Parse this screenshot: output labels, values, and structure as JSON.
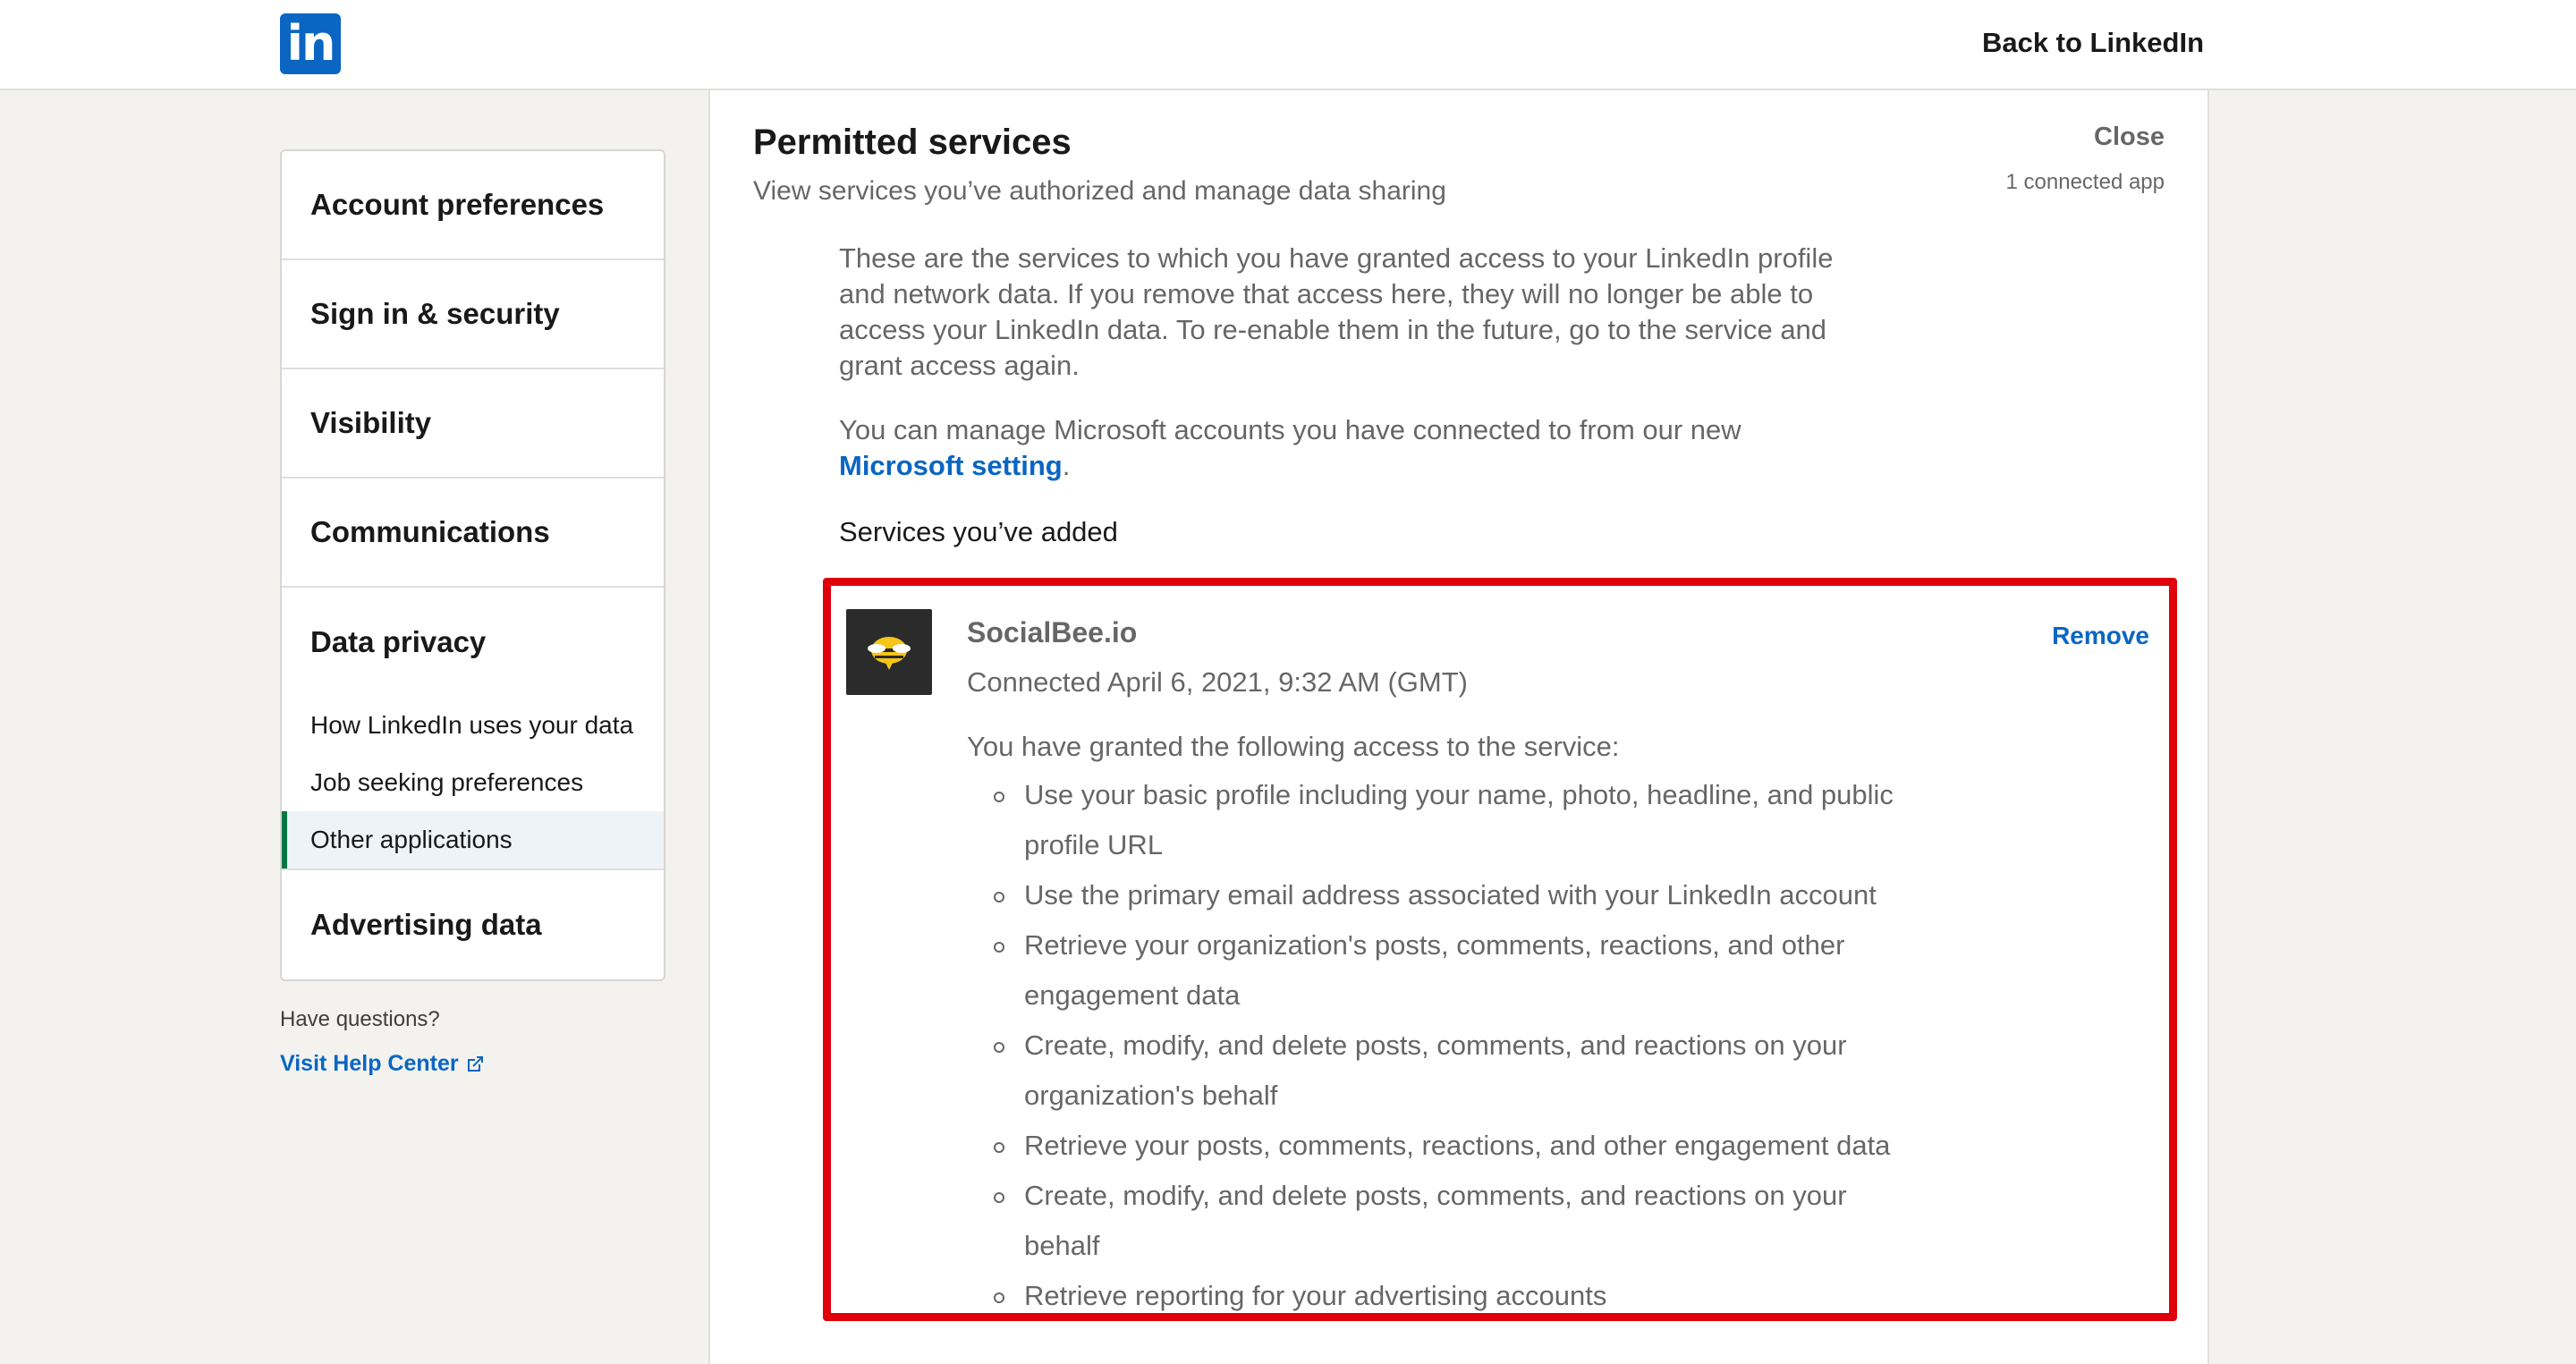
{
  "header": {
    "logo_text": "in",
    "back_link": "Back to LinkedIn"
  },
  "sidebar": {
    "items": [
      {
        "label": "Account preferences"
      },
      {
        "label": "Sign in & security"
      },
      {
        "label": "Visibility"
      },
      {
        "label": "Communications"
      },
      {
        "label": "Data privacy",
        "sub_items": [
          {
            "label": "How LinkedIn uses your data"
          },
          {
            "label": "Job seeking preferences"
          },
          {
            "label": "Other applications",
            "active": true
          }
        ]
      },
      {
        "label": "Advertising data"
      }
    ],
    "help_question": "Have questions?",
    "help_link": "Visit Help Center"
  },
  "main": {
    "title": "Permitted services",
    "subtitle": "View services you’ve authorized and manage data sharing",
    "close_label": "Close",
    "connected_count": "1 connected app",
    "description": "These are the services to which you have granted access to your LinkedIn profile and network data. If you remove that access here, they will no longer be able to access your LinkedIn data. To re-enable them in the future, go to the service and grant access again.",
    "microsoft_text": "You can manage Microsoft accounts you have connected to from our new",
    "microsoft_link": "Microsoft setting",
    "microsoft_period": ".",
    "services_added_label": "Services you’ve added",
    "service": {
      "name": "SocialBee.io",
      "connected": "Connected April 6, 2021, 9:32 AM (GMT)",
      "remove_label": "Remove",
      "access_intro": "You have granted the following access to the service:",
      "permissions": [
        "Use your basic profile including your name, photo, headline, and public profile URL",
        "Use the primary email address associated with your LinkedIn account",
        "Retrieve your organization's posts, comments, reactions, and other engagement data",
        "Create, modify, and delete posts, comments, and reactions on your organization's behalf",
        "Retrieve your posts, comments, reactions, and other engagement data",
        "Create, modify, and delete posts, comments, and reactions on your behalf",
        "Retrieve reporting for your advertising accounts"
      ]
    }
  },
  "colors": {
    "brand": "#0a66c2",
    "highlight": "#e0000b",
    "active_indicator": "#057642"
  },
  "icons": {
    "external_link": "external-link-icon",
    "app_logo": "bee-icon"
  }
}
